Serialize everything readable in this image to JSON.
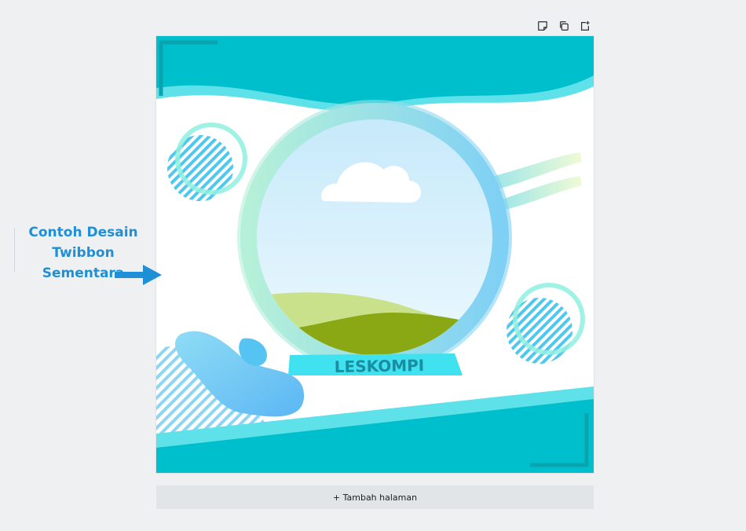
{
  "toolbar": {
    "icons": [
      "note-icon",
      "duplicate-page-icon",
      "add-page-icon"
    ]
  },
  "canvas": {
    "banner_text": "LESKOMPI",
    "colors": {
      "teal": "#00bfcc",
      "light_teal": "#5fe1ea",
      "ring_blue": "#7fd0f5",
      "ring_mint": "#b5f0d8",
      "sky_top": "#c6e9fa",
      "sky_bottom": "#eef9fe",
      "hill_light": "#c9e18b",
      "hill_dark": "#8aa814",
      "banner": "#3fe2ee",
      "banner_text": "#1b8da3"
    }
  },
  "annotation": {
    "lines": [
      "Contoh Desain",
      "Twibbon Sementara"
    ],
    "color": "#1f8fd6"
  },
  "add_page": {
    "label": "+ Tambah halaman"
  }
}
